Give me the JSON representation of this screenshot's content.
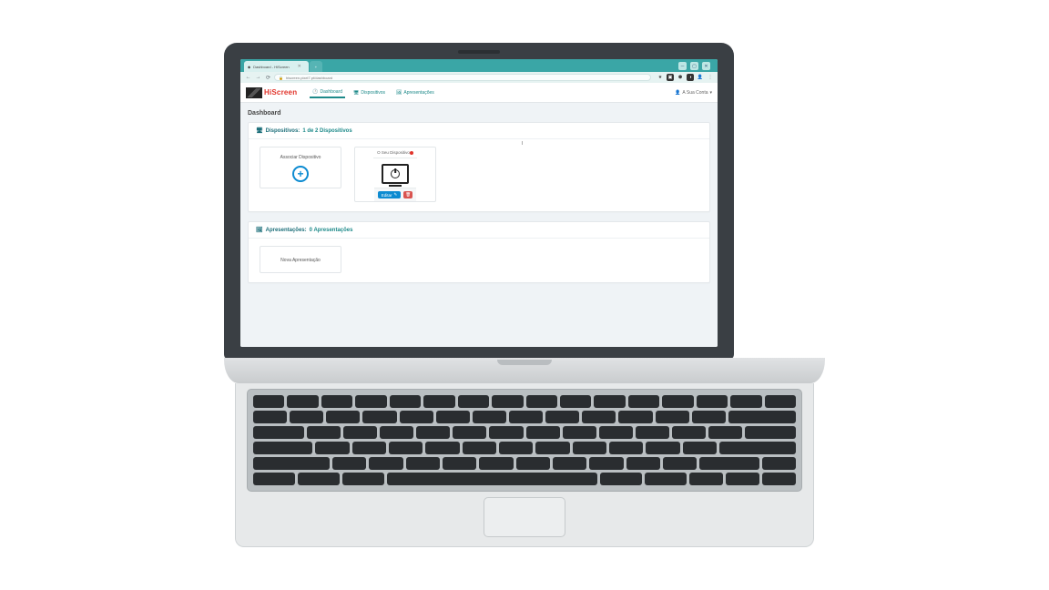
{
  "browser": {
    "tab_title": "Dashboard - HiScreen",
    "url": "hiscreen.pixel7.pt/dashboard"
  },
  "brand": {
    "name": "HiScreen"
  },
  "nav": {
    "dashboard": "Dashboard",
    "dispositivos": "Dispositivos",
    "apresentacoes": "Apresentações",
    "account": "A Sua Conta"
  },
  "page": {
    "title": "Dashboard"
  },
  "devices": {
    "header_label": "Dispositivos:",
    "header_count": "1 de 2 Dispositivos",
    "assoc_label": "Associar Dispositivo",
    "card0": {
      "title": "O Seu Dispositivo",
      "edit": "Editar"
    }
  },
  "presentations": {
    "header_label": "Apresentações:",
    "header_count": "0 Apresentações",
    "new_label": "Nova Apresentação"
  }
}
